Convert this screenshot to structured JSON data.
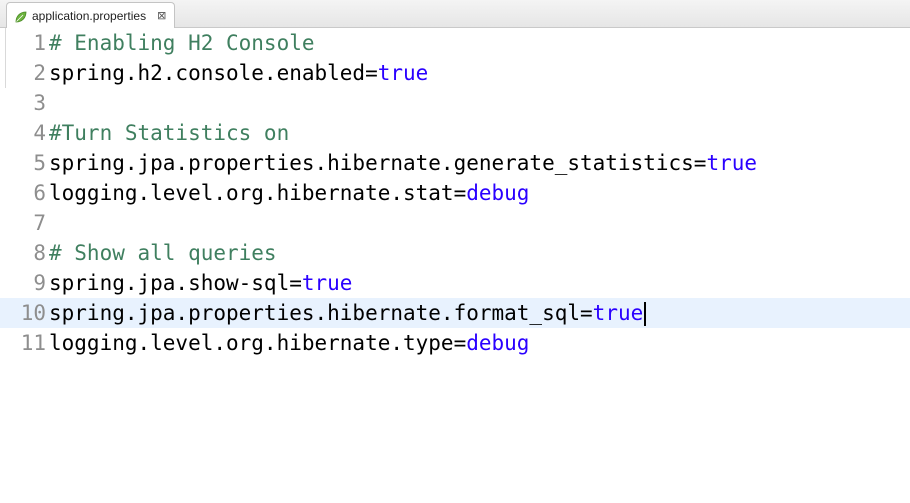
{
  "tab": {
    "icon": "leaf-icon",
    "label": "application.properties",
    "close_symbol": "⊠"
  },
  "colors": {
    "comment": "#3f7f5f",
    "key": "#000000",
    "value": "#2a00ff",
    "line_number": "#8e8e8e",
    "current_line": "#e8f2fe"
  },
  "lines": [
    {
      "num": "1",
      "comment": "# Enabling H2 Console"
    },
    {
      "num": "2",
      "key": "spring.h2.console.enabled",
      "eq": "=",
      "value": "true"
    },
    {
      "num": "3"
    },
    {
      "num": "4",
      "comment": "#Turn Statistics on"
    },
    {
      "num": "5",
      "key": "spring.jpa.properties.hibernate.generate_statistics",
      "eq": "=",
      "value": "true"
    },
    {
      "num": "6",
      "key": "logging.level.org.hibernate.stat",
      "eq": "=",
      "value": "debug"
    },
    {
      "num": "7"
    },
    {
      "num": "8",
      "comment": "# Show all queries"
    },
    {
      "num": "9",
      "key": "spring.jpa.show-sql",
      "eq": "=",
      "value": "true"
    },
    {
      "num": "10",
      "key": "spring.jpa.properties.hibernate.format_sql",
      "eq": "=",
      "value": "true"
    },
    {
      "num": "11",
      "key": "logging.level.org.hibernate.type",
      "eq": "=",
      "value": "debug"
    }
  ]
}
